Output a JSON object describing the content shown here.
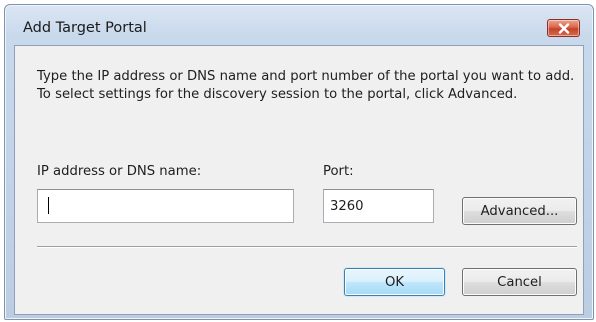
{
  "window": {
    "title": "Add Target Portal"
  },
  "dialog": {
    "description": "Type the IP address or DNS name and port number of the portal you want to add. To select settings for the discovery session to the portal, click Advanced.",
    "ip_label": "IP address or DNS name:",
    "ip_value": "",
    "port_label": "Port:",
    "port_value": "3260",
    "advanced_label": "Advanced...",
    "ok_label": "OK",
    "cancel_label": "Cancel"
  },
  "icons": {
    "close": "close-icon"
  },
  "colors": {
    "frame": "#c9d9ec",
    "client": "#f0f0f0",
    "close_button": "#d9664c",
    "default_button_border": "#3c7fb1"
  }
}
